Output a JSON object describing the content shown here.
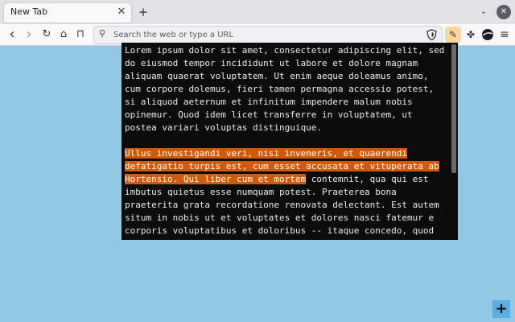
{
  "tabs": [
    {
      "title": "New Tab",
      "close": "✕"
    }
  ],
  "tabstrip": {
    "new_tab": "+",
    "list_tabs": "⌄",
    "window_close": "✕"
  },
  "nav": {
    "back": "‹",
    "forward": "›",
    "reload": "↻",
    "home": "⌂",
    "bookmarks": "⊓"
  },
  "urlbar": {
    "placeholder": "Search the web or type a URL",
    "value": "",
    "search_icon": "⚲"
  },
  "toolbar": {
    "extension": "✎",
    "puzzle": "✤",
    "account": "●",
    "menu": "≡"
  },
  "terminal": {
    "lines_before": [
      "Lorem ipsum dolor sit amet, consectetur adipiscing elit, sed",
      "do eiusmod tempor incididunt ut labore et dolore magnam",
      "aliquam quaerat voluptatem. Ut enim aeque doleamus animo,",
      "cum corpore dolemus, fieri tamen permagna accessio potest,",
      "si aliquod aeternum et infinitum impendere malum nobis",
      "opinemur. Quod idem licet transferre in voluptatem, ut",
      "postea variari voluptas distinguique.",
      ""
    ],
    "selected_lines": [
      "Ullus investigandi veri, nisi inveneris, et quaerendi",
      "defatigatio turpis est, cum esset accusata et vituperata ab"
    ],
    "selected_tail": "Hortensio. Qui liber cum et mortem",
    "unselected_tail": " contemnit, qua qui est",
    "lines_after": [
      "imbutus quietus esse numquam potest. Praeterea bona",
      "praeterita grata recordatione renovata delectant. Est autem",
      "situm in nobis ut et voluptates et dolores nasci fatemur e",
      "corporis voluptatibus et doloribus -- itaque concedo, quod"
    ]
  },
  "desktop": {
    "add_button": "+"
  },
  "colors": {
    "desktop": "#92c8e6",
    "selection": "#d0590a",
    "terminal_bg": "#0c0c0c"
  }
}
